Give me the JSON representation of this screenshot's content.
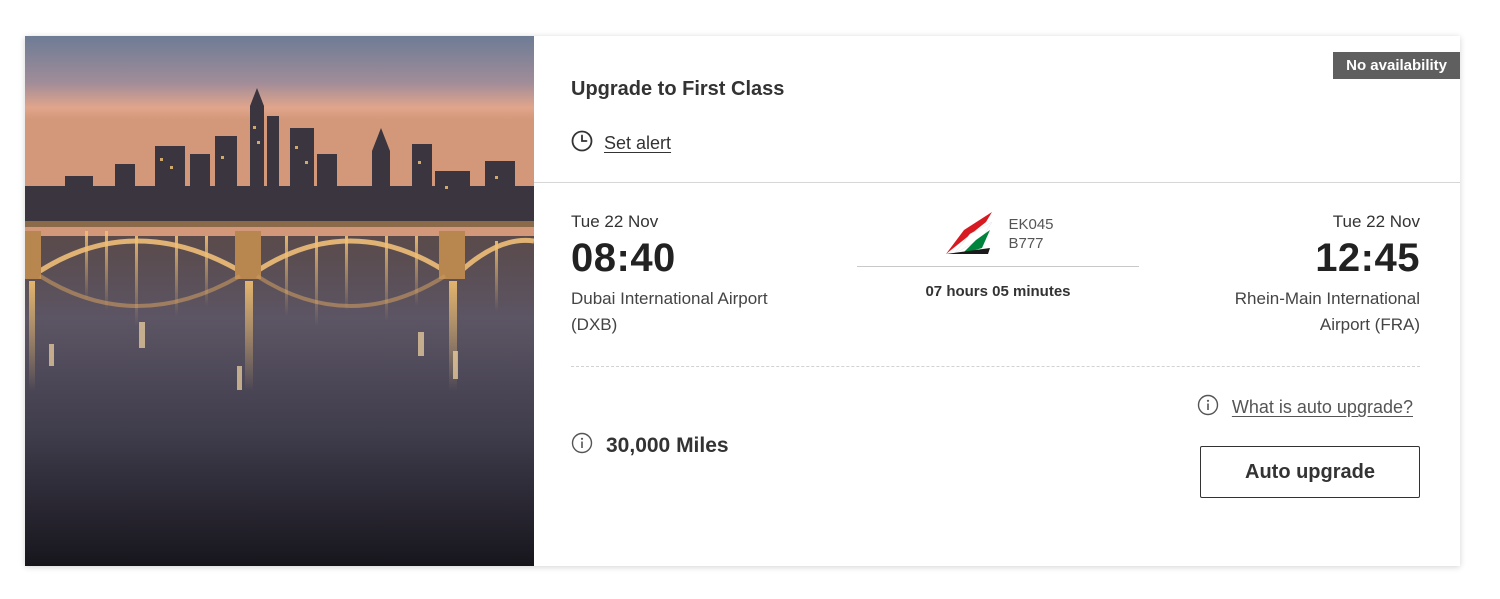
{
  "offer": {
    "availability_badge": "No availability",
    "title": "Upgrade to First Class",
    "set_alert_label": "Set alert"
  },
  "flight": {
    "departure": {
      "date": "Tue 22 Nov",
      "time": "08:40",
      "airport_line1": "Dubai International Airport",
      "airport_line2": "(DXB)"
    },
    "arrival": {
      "date": "Tue 22 Nov",
      "time": "12:45",
      "airport_line1": "Rhein-Main International",
      "airport_line2": "Airport (FRA)"
    },
    "flight_number": "EK045",
    "aircraft": "B777",
    "duration": "07 hours 05 minutes",
    "airline_logo_icon": "emirates-tail-fin-icon"
  },
  "upgrade": {
    "miles": "30,000 Miles",
    "what_is_link": "What is auto upgrade?",
    "auto_upgrade_button": "Auto upgrade"
  },
  "icons": {
    "alert": "clock-icon",
    "info": "info-circle-icon"
  },
  "colors": {
    "badge_bg": "#5f5f5f",
    "text": "#333333",
    "emirates_red": "#d71a21",
    "emirates_green": "#00843d"
  }
}
